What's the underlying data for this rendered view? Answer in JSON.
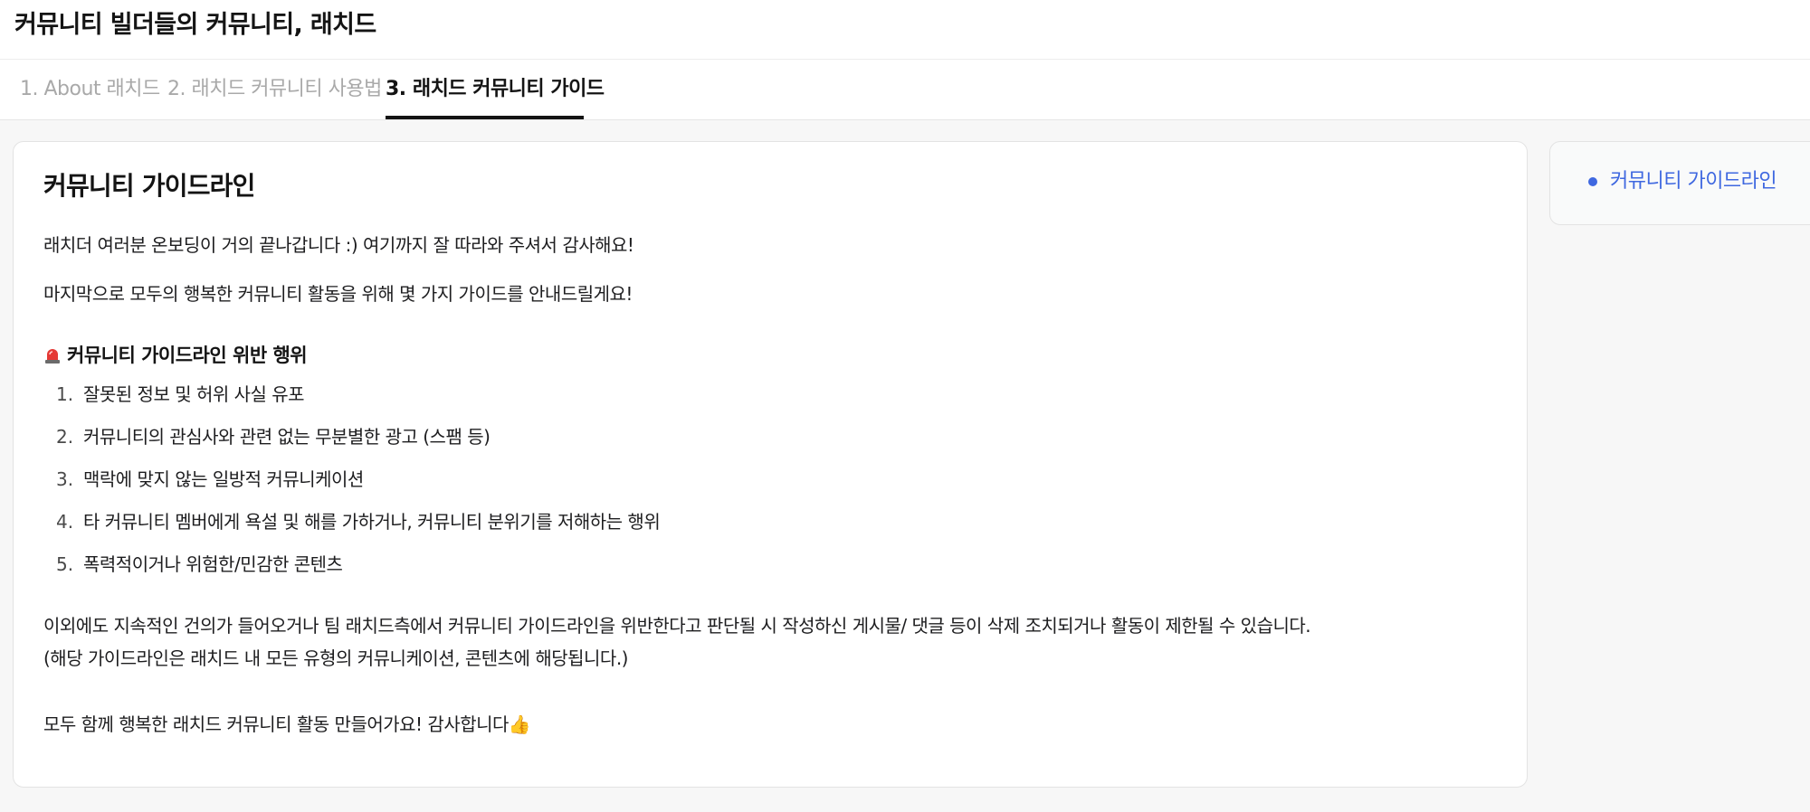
{
  "header": {
    "title": "커뮤니티 빌더들의 커뮤니티, 래치드"
  },
  "tabs": [
    {
      "label": "1. About 래치드",
      "active": false
    },
    {
      "label": "2. 래치드 커뮤니티 사용법",
      "active": false
    },
    {
      "label": "3. 래치드 커뮤니티 가이드",
      "active": true
    }
  ],
  "main": {
    "heading": "커뮤니티 가이드라인",
    "intro": [
      "래치더 여러분 온보딩이 거의 끝나갑니다 :) 여기까지 잘 따라와 주셔서 감사해요!",
      "마지막으로 모두의 행복한 커뮤니티 활동을 위해 몇 가지 가이드를 안내드릴게요!"
    ],
    "violations": {
      "title": "커뮤니티 가이드라인 위반 행위",
      "icon": "alarm-light-icon",
      "items": [
        {
          "num": "1.",
          "text": "잘못된 정보 및 허위 사실 유포"
        },
        {
          "num": "2.",
          "text": "커뮤니티의 관심사와 관련 없는 무분별한 광고 (스팸 등)"
        },
        {
          "num": "3.",
          "text": "맥락에 맞지 않는 일방적 커뮤니케이션"
        },
        {
          "num": "4.",
          "text": "타 커뮤니티 멤버에게 욕설 및 해를 가하거나, 커뮤니티 분위기를 저해하는 행위"
        },
        {
          "num": "5.",
          "text": "폭력적이거나 위험한/민감한 콘텐츠"
        }
      ]
    },
    "notice": [
      "이외에도 지속적인 건의가 들어오거나 팀 래치드측에서 커뮤니티 가이드라인을 위반한다고 판단될 시 작성하신 게시물/ 댓글 등이 삭제 조치되거나 활동이 제한될 수 있습니다.",
      "(해당 가이드라인은 래치드 내 모든 유형의 커뮤니케이션, 콘텐츠에 해당됩니다.)"
    ],
    "closing": "모두 함께 행복한 래치드 커뮤니티 활동 만들어가요! 감사합니다👍"
  },
  "toc": {
    "items": [
      {
        "label": "커뮤니티 가이드라인"
      }
    ]
  },
  "colors": {
    "accent": "#3f68e0",
    "text": "#1d1d1f",
    "muted_tab": "#a9a9a9",
    "alarm": "#e53935"
  }
}
